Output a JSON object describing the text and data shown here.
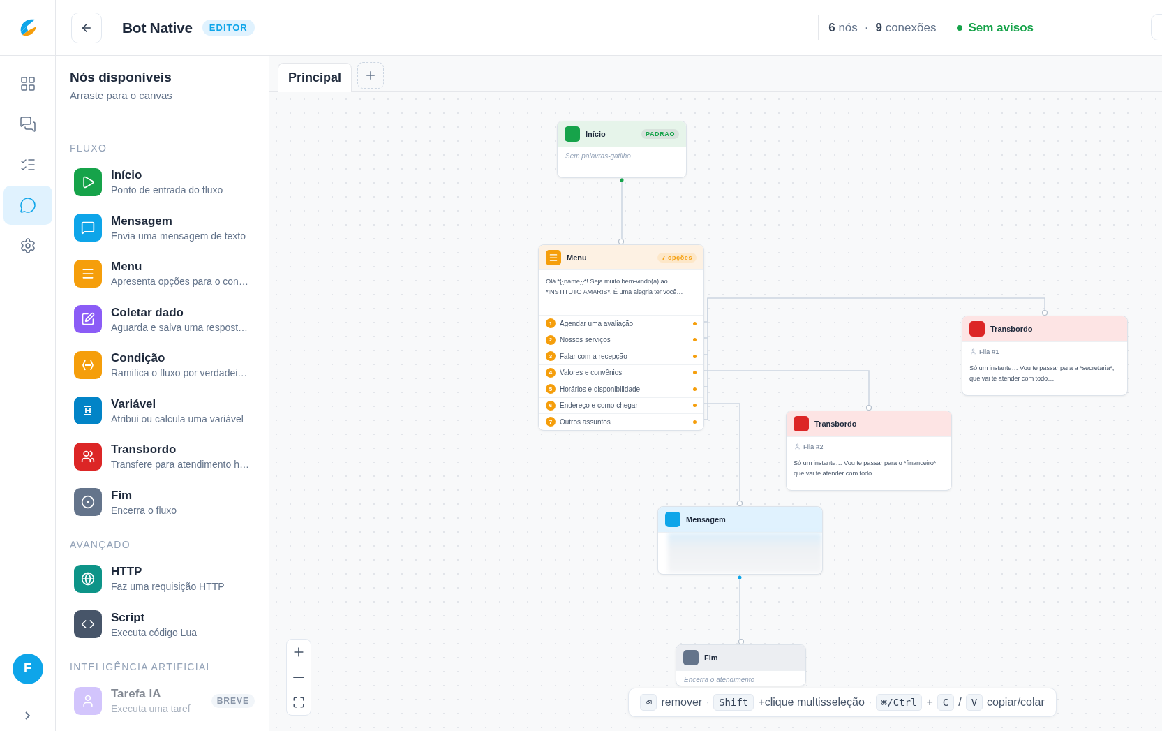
{
  "header": {
    "title": "Bot Native",
    "badge": "EDITOR",
    "stats": [
      "**6** nós",
      "**9** conexões"
    ],
    "stats_separator": "·",
    "status": "Sem avisos"
  },
  "rail": {
    "items": [
      {
        "kind": "grid",
        "selected": false
      },
      {
        "kind": "chat",
        "selected": false
      },
      {
        "kind": "checklist",
        "selected": false
      },
      {
        "kind": "ai",
        "selected": true
      },
      {
        "kind": "settings",
        "selected": false
      }
    ],
    "avatar": "F"
  },
  "sidebar": {
    "title": "Nós disponíveis",
    "subtitle": "Arraste para o canvas",
    "sections": [
      {
        "title": "FLUXO",
        "items": [
          {
            "kind": "start",
            "name": "Início",
            "description": "Ponto de entrada do fluxo",
            "disabled": false
          },
          {
            "kind": "message",
            "name": "Mensagem",
            "description": "Envia uma mensagem de texto",
            "disabled": false
          },
          {
            "kind": "menu",
            "name": "Menu",
            "description": "Apresenta opções para o con…",
            "disabled": false
          },
          {
            "kind": "collect",
            "name": "Coletar dado",
            "description": "Aguarda e salva uma respost…",
            "disabled": false
          },
          {
            "kind": "condition",
            "name": "Condição",
            "description": "Ramifica o fluxo por verdadei…",
            "disabled": false
          },
          {
            "kind": "variable",
            "name": "Variável",
            "description": "Atribui ou calcula uma variável",
            "disabled": false
          },
          {
            "kind": "handoff",
            "name": "Transbordo",
            "description": "Transfere para atendimento h…",
            "disabled": false
          },
          {
            "kind": "end",
            "name": "Fim",
            "description": "Encerra o fluxo",
            "disabled": false
          }
        ]
      },
      {
        "title": "AVANÇADO",
        "items": [
          {
            "kind": "http",
            "name": "HTTP",
            "description": "Faz uma requisição HTTP",
            "disabled": false
          },
          {
            "kind": "script",
            "name": "Script",
            "description": "Executa código Lua",
            "disabled": false
          }
        ]
      },
      {
        "title": "INTELIGÊNCIA ARTIFICIAL",
        "items": [
          {
            "kind": "ai_task",
            "name": "Tarefa IA",
            "description": "Executa uma taref",
            "disabled": true,
            "badge": "BREVE"
          }
        ]
      }
    ]
  },
  "tabs": [
    {
      "label": "Principal",
      "selected": true
    }
  ],
  "nodes": [
    {
      "kind": "start",
      "title": "Início",
      "badge": "PADRÃO",
      "note": "Sem palavras-gatilho"
    },
    {
      "kind": "menu",
      "title": "Menu",
      "badge": "7 opções",
      "text": "Olá *{{name}}*! Seja muito bem-vindo(a) ao *INSTITUTO AMARIS*. É uma alegria ter você…",
      "options": [
        {
          "number": "1",
          "label": "Agendar uma avaliação"
        },
        {
          "number": "2",
          "label": "Nossos serviços"
        },
        {
          "number": "3",
          "label": "Falar com a recepção"
        },
        {
          "number": "4",
          "label": "Valores e convênios"
        },
        {
          "number": "5",
          "label": "Horários e disponibilidade"
        },
        {
          "number": "6",
          "label": "Endereço e como chegar"
        },
        {
          "number": "7",
          "label": "Outros assuntos"
        }
      ]
    },
    {
      "kind": "handoff",
      "title": "Transbordo",
      "queue": "Fila #1",
      "text": "Só um instante… Vou te passar para a *secretaria*, que vai te atender com todo…"
    },
    {
      "kind": "handoff",
      "title": "Transbordo",
      "queue": "Fila #2",
      "text": "Só um instante… Vou te passar para o *financeiro*, que vai te atender com todo…"
    },
    {
      "kind": "message",
      "title": "Mensagem",
      "blurred": true
    },
    {
      "kind": "end",
      "title": "Fim",
      "note": "Encerra o atendimento"
    }
  ],
  "shortcuts": [
    {
      "kind": "key",
      "text": "⌫"
    },
    {
      "kind": "text",
      "text": "remover"
    },
    {
      "kind": "sep",
      "text": "·"
    },
    {
      "kind": "key",
      "text": "Shift"
    },
    {
      "kind": "text",
      "text": "+clique multisseleção"
    },
    {
      "kind": "sep",
      "text": "·"
    },
    {
      "kind": "key",
      "text": "⌘/Ctrl"
    },
    {
      "kind": "text",
      "text": "+"
    },
    {
      "kind": "key",
      "text": "C"
    },
    {
      "kind": "text",
      "text": "/"
    },
    {
      "kind": "key",
      "text": "V"
    },
    {
      "kind": "text",
      "text": "copiar/colar"
    }
  ]
}
